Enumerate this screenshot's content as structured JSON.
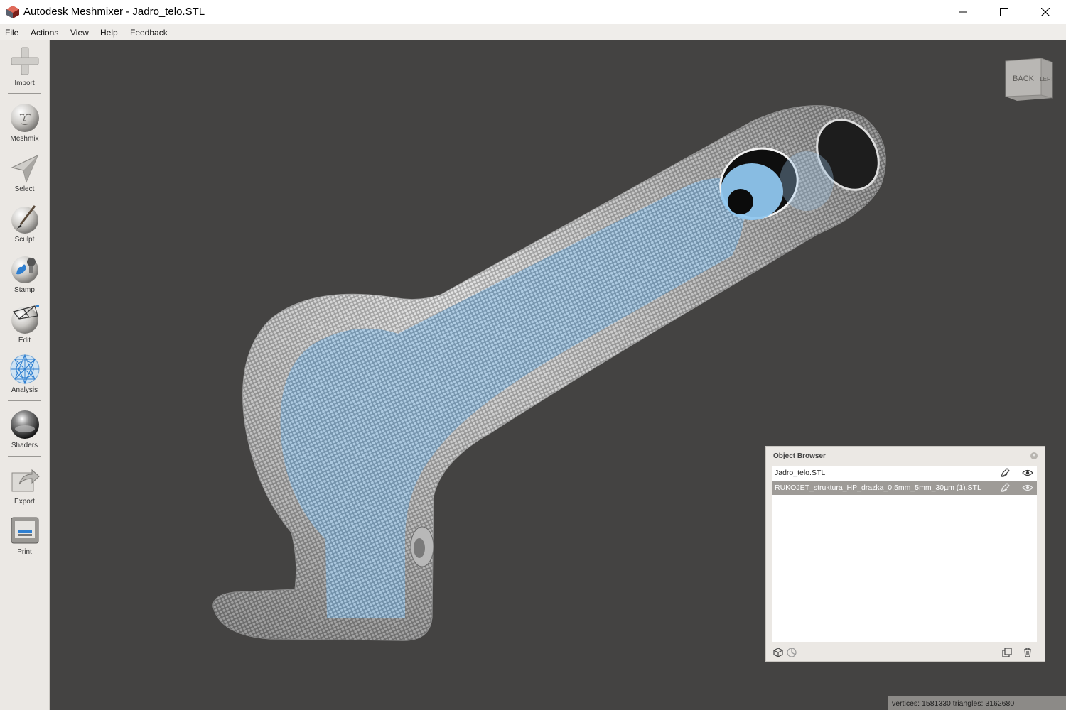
{
  "window": {
    "title": "Autodesk Meshmixer - Jadro_telo.STL",
    "minimize_icon": "minimize-icon",
    "maximize_icon": "maximize-icon",
    "close_icon": "close-icon"
  },
  "menu": {
    "items": [
      "File",
      "Actions",
      "View",
      "Help",
      "Feedback"
    ]
  },
  "toolbar": {
    "items": [
      {
        "label": "Import",
        "icon": "plus-icon"
      },
      {
        "label": "Meshmix",
        "icon": "face-sphere-icon"
      },
      {
        "label": "Select",
        "icon": "arrow-pointer-icon"
      },
      {
        "label": "Sculpt",
        "icon": "brush-sphere-icon"
      },
      {
        "label": "Stamp",
        "icon": "stamp-sphere-icon"
      },
      {
        "label": "Edit",
        "icon": "wire-sphere-icon"
      },
      {
        "label": "Analysis",
        "icon": "mesh-sphere-icon"
      },
      {
        "label": "Shaders",
        "icon": "shiny-sphere-icon"
      },
      {
        "label": "Export",
        "icon": "export-icon"
      },
      {
        "label": "Print",
        "icon": "printer-icon"
      }
    ]
  },
  "viewcube": {
    "faces": [
      "BACK",
      "LEFT"
    ]
  },
  "object_browser": {
    "title": "Object Browser",
    "objects": [
      {
        "name": "Jadro_telo.STL",
        "selected": false
      },
      {
        "name": "RUKOJET_struktura_HP_drazka_0,5mm_5mm_30µm (1).STL",
        "selected": true
      }
    ]
  },
  "status_bar": {
    "text": "vertices: 1581330 triangles: 3162680"
  },
  "colors": {
    "viewport_bg": "#444342",
    "mesh_gray": "#c8c8c8",
    "inner_blue": "#9cc4e4",
    "selection": "#9e9b97"
  }
}
